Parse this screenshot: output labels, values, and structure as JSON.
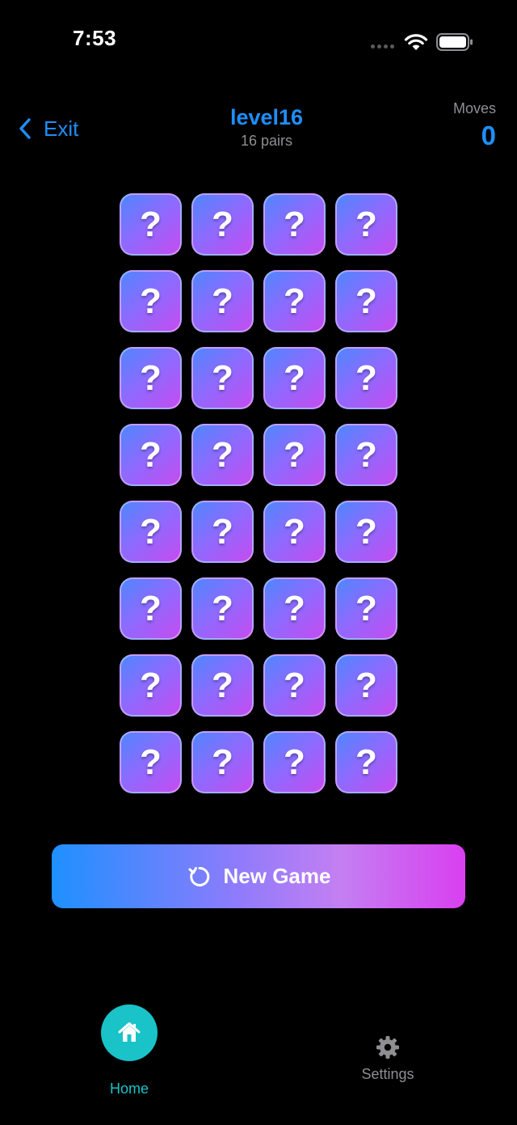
{
  "status_bar": {
    "time": "7:53",
    "icons": [
      "cellular-dots-icon",
      "wifi-icon",
      "battery-icon"
    ]
  },
  "header": {
    "exit_label": "Exit",
    "title": "level16",
    "subtitle": "16 pairs",
    "moves_label": "Moves",
    "moves_count": "0"
  },
  "board": {
    "rows": 8,
    "columns": 4,
    "hidden_symbol": "?"
  },
  "new_game": {
    "label": "New Game",
    "icon": "refresh-icon"
  },
  "tab_bar": {
    "home_label": "Home",
    "home_icon": "home-icon",
    "settings_label": "Settings",
    "settings_icon": "gear-icon"
  },
  "colors": {
    "background": "#000000",
    "accent_blue": "#1e8ffb",
    "muted_gray": "#8e8e93",
    "tab_active_teal": "#19c3c8",
    "card_gradient_start": "#4f86ff",
    "card_gradient_end": "#c54cf0"
  }
}
